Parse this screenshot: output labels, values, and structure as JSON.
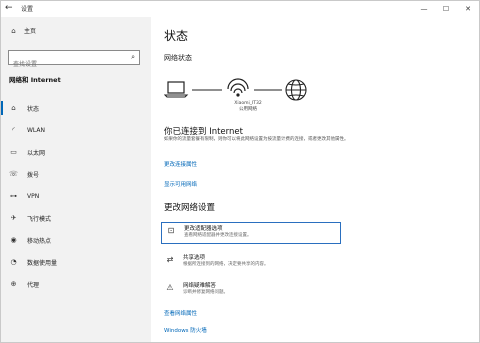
{
  "window": {
    "title": "设置",
    "back": "←",
    "minimize": "—",
    "maximize": "☐",
    "close": "✕"
  },
  "sidebar": {
    "home_label": "主页",
    "search_placeholder": "查找设置",
    "section_title": "网络和 Internet",
    "items": [
      {
        "label": "状态",
        "icon": "⌂",
        "selected": true
      },
      {
        "label": "WLAN",
        "icon": "◜"
      },
      {
        "label": "以太网",
        "icon": "▭"
      },
      {
        "label": "拨号",
        "icon": "☏"
      },
      {
        "label": "VPN",
        "icon": "⊶"
      },
      {
        "label": "飞行模式",
        "icon": "✈"
      },
      {
        "label": "移动热点",
        "icon": "◉"
      },
      {
        "label": "数据使用量",
        "icon": "◔"
      },
      {
        "label": "代理",
        "icon": "⊕"
      }
    ]
  },
  "main": {
    "title": "状态",
    "network_status_heading": "网络状态",
    "ssid": "Xiaomi_IT32",
    "network_type": "公用网络",
    "connected_heading": "你已连接到 Internet",
    "connected_desc": "如果你的流量套餐有限制，则你可以将此网络设置为按流量计费的连接，或者更改其他属性。",
    "change_properties_link": "更改连接属性",
    "show_available_link": "显示可用网络",
    "change_settings_heading": "更改网络设置",
    "options": [
      {
        "title": "更改适配器选项",
        "sub": "查看网络适配器并更改连接设置。",
        "icon": "⊡"
      },
      {
        "title": "共享选项",
        "sub": "根据所连接到的网络，决定要共享的内容。",
        "icon": "⇄"
      },
      {
        "title": "网络疑难解答",
        "sub": "诊断并修复网络问题。",
        "icon": "⚠"
      }
    ],
    "view_properties_link": "查看网络属性",
    "firewall_link": "Windows 防火墙"
  }
}
